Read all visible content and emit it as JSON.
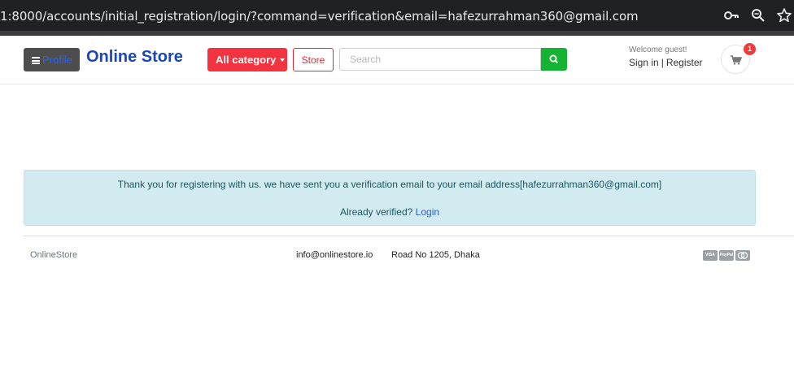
{
  "browser": {
    "url": "1:8000/accounts/initial_registration/login/?command=verification&email=hafezurrahman360@gmail.com",
    "icons": [
      "key-icon",
      "zoom-icon",
      "star-icon"
    ]
  },
  "header": {
    "profile_label": "Profile",
    "brand": "Online Store",
    "category_label": "All category",
    "store_label": "Store",
    "search_placeholder": "Search",
    "welcome": "Welcome guest!",
    "sign_in": "Sign in",
    "separator": "|",
    "register": "Register",
    "cart_count": "1"
  },
  "alert": {
    "message": "Thank you for registering with us. we have sent you a verification email to your email address[hafezurrahman360@gmail.com]",
    "verified_prefix": "Already verified?",
    "login_link": "Login"
  },
  "footer": {
    "brand": "OnlineStore",
    "email": "info@onlinestore.io",
    "address": "Road No 1205, Dhaka",
    "payment_icons": [
      "visa",
      "paypal",
      "mastercard"
    ]
  },
  "colors": {
    "brand_blue": "#1a47b8",
    "category_red": "#f3333f",
    "search_green": "#16b233",
    "alert_bg": "#d1ebf1",
    "badge_red": "#ee3b3b"
  }
}
